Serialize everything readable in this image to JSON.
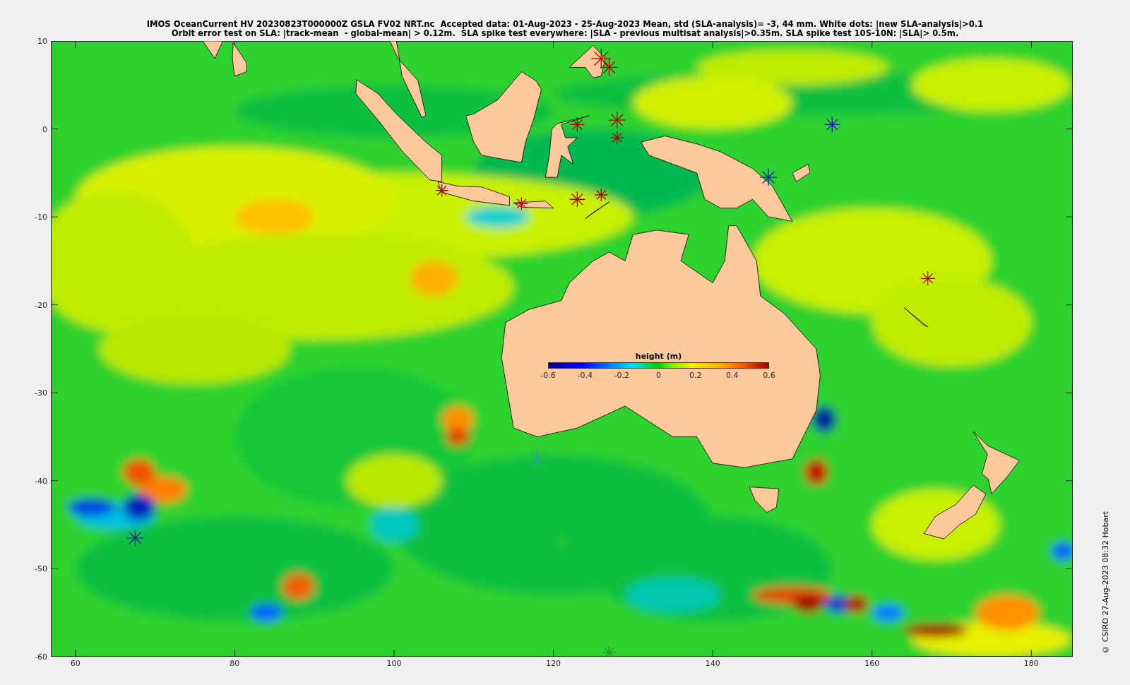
{
  "title_lines": [
    "IMOS OceanCurrent HV 20230823T000000Z GSLA FV02 NRT.nc  Accepted data: 01-Aug-2023 - 25-Aug-2023 Mean, std (SLA-analysis)= -3, 44 mm. White dots: |new SLA-analysis|>0.1",
    "Orbit error test on SLA: |track-mean  - global-mean| > 0.12m.  SLA spike test everywhere: |SLA - previous multisat analysis|>0.35m. SLA spike test 10S-10N: |SLA|> 0.5m."
  ],
  "axes": {
    "x_ticks": [
      "60",
      "80",
      "100",
      "120",
      "140",
      "160",
      "180"
    ],
    "y_ticks": [
      "10",
      "0",
      "-10",
      "-20",
      "-30",
      "-40",
      "-50",
      "-60"
    ]
  },
  "colorbar": {
    "label": "height (m)",
    "ticks": [
      "-0.6",
      "-0.4",
      "-0.2",
      "0",
      "0.2",
      "0.4",
      "0.6"
    ]
  },
  "credit": "© CSIRO 27-Aug-2023 08:32 Hobart"
}
